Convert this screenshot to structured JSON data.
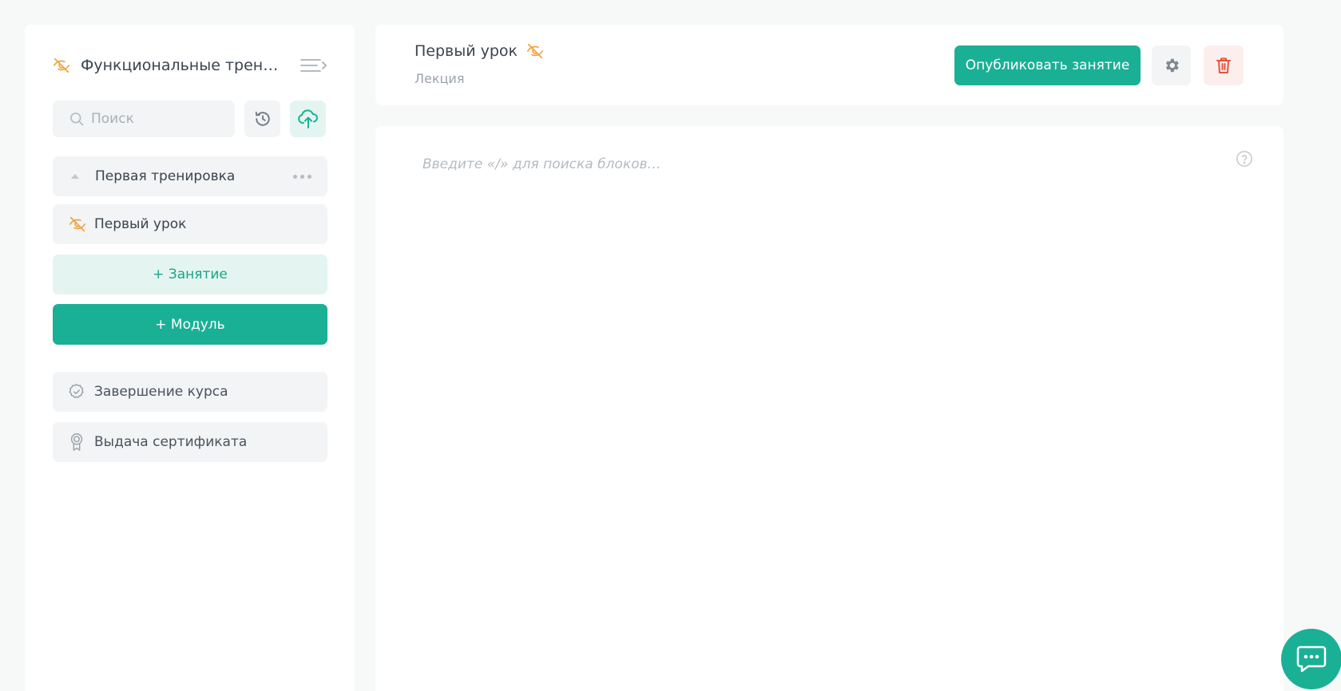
{
  "sidebar": {
    "course_title": "Функциональные трени...",
    "search": {
      "placeholder": "Поиск",
      "value": ""
    },
    "module": {
      "label": "Первая тренировка"
    },
    "lesson": {
      "label": "Первый урок"
    },
    "add_lesson_label": "+ Занятие",
    "add_module_label": "+ Модуль",
    "finish_label": "Завершение курса",
    "certificate_label": "Выдача сертификата"
  },
  "topbar": {
    "lesson_title": "Первый урок",
    "lesson_type": "Лекция",
    "publish_label": "Опубликовать занятие"
  },
  "editor": {
    "placeholder": "Введите «/» для поиска блоков…"
  },
  "colors": {
    "accent": "#1ab096",
    "accent_light": "#e4f5f1",
    "hidden_icon": "#f2a03d",
    "danger": "#e5533d",
    "surface": "#f2f4f5"
  },
  "icons": {
    "hidden": "eye-off-icon",
    "collapse": "collapse-sidebar-icon",
    "search": "search-icon",
    "history": "history-icon",
    "upload": "cloud-upload-icon",
    "caret": "caret-up-icon",
    "more": "more-dots-icon",
    "finish": "badge-check-icon",
    "certificate": "award-icon",
    "settings": "gear-icon",
    "delete": "trash-icon",
    "help": "help-circle-icon",
    "chat": "chat-icon"
  }
}
